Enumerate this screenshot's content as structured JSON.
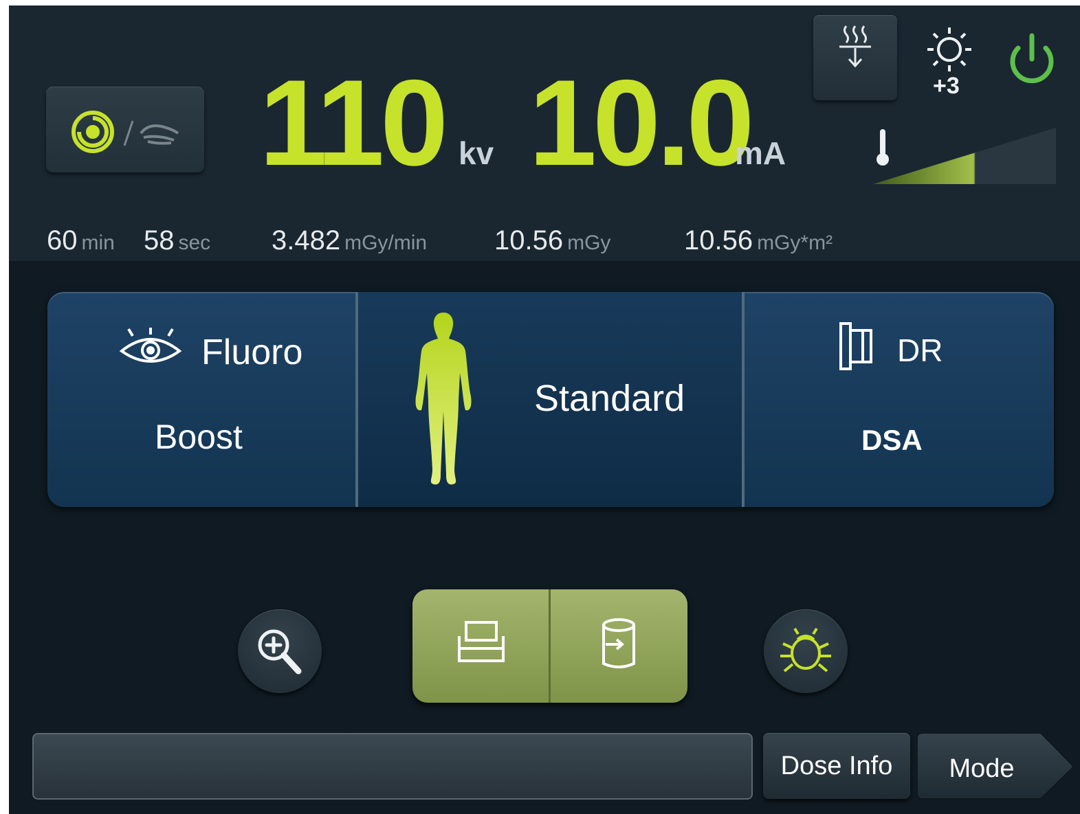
{
  "header": {
    "kv_value": "110",
    "kv_unit": "kv",
    "ma_value": "10.0",
    "ma_unit": "mA",
    "brightness_level": "+3"
  },
  "stats": {
    "time_min": "60",
    "time_min_unit": "min",
    "time_sec": "58",
    "time_sec_unit": "sec",
    "dose_rate": "3.482",
    "dose_rate_unit": "mGy/min",
    "dose": "10.56",
    "dose_unit": "mGy",
    "dap": "10.56",
    "dap_unit": "mGy*m²"
  },
  "panels": {
    "fluoro_label": "Fluoro",
    "fluoro_mode": "Boost",
    "patient_label": "Standard",
    "dr_label": "DR",
    "dr_mode": "DSA"
  },
  "footer": {
    "dose_info_label": "Dose Info",
    "mode_label": "Mode"
  },
  "colors": {
    "accent": "#c6e22a",
    "power": "#5cc04a",
    "panel": "#1a3d5e"
  }
}
